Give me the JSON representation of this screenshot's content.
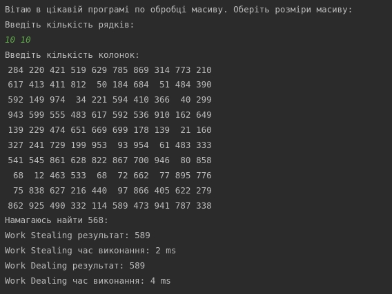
{
  "console": {
    "welcome": "Вітаю в цікавій програмі по обробці масиву. Оберіть розміри масиву:",
    "rows_prompt": "Введіть кількість рядків:",
    "user_input": "10 10",
    "cols_prompt": "Введіть кількість колонок:",
    "matrix": [
      [
        "284",
        "220",
        "421",
        "519",
        "629",
        "785",
        "869",
        "314",
        "773",
        "210"
      ],
      [
        "617",
        "413",
        "411",
        "812",
        "50",
        "184",
        "684",
        "51",
        "484",
        "390"
      ],
      [
        "592",
        "149",
        "974",
        "34",
        "221",
        "594",
        "410",
        "366",
        "40",
        "299"
      ],
      [
        "943",
        "599",
        "555",
        "483",
        "617",
        "592",
        "536",
        "910",
        "162",
        "649"
      ],
      [
        "139",
        "229",
        "474",
        "651",
        "669",
        "699",
        "178",
        "139",
        "21",
        "160"
      ],
      [
        "327",
        "241",
        "729",
        "199",
        "953",
        "93",
        "954",
        "61",
        "483",
        "333"
      ],
      [
        "541",
        "545",
        "861",
        "628",
        "822",
        "867",
        "700",
        "946",
        "80",
        "858"
      ],
      [
        "68",
        "12",
        "463",
        "533",
        "68",
        "72",
        "662",
        "77",
        "895",
        "776"
      ],
      [
        "75",
        "838",
        "627",
        "216",
        "440",
        "97",
        "866",
        "405",
        "622",
        "279"
      ],
      [
        "862",
        "925",
        "490",
        "332",
        "114",
        "589",
        "473",
        "941",
        "787",
        "338"
      ]
    ],
    "search_line": "Намагаюсь найти 568:",
    "ws_result": "Work Stealing результат: 589",
    "ws_time": "Work Stealing час виконання: 2 ms",
    "wd_result": "Work Dealing результат: 589",
    "wd_time": "Work Dealing час виконання: 4 ms"
  },
  "colors": {
    "background": "#2b2b2b",
    "text": "#bbbbbb",
    "input": "#5fa84a"
  }
}
